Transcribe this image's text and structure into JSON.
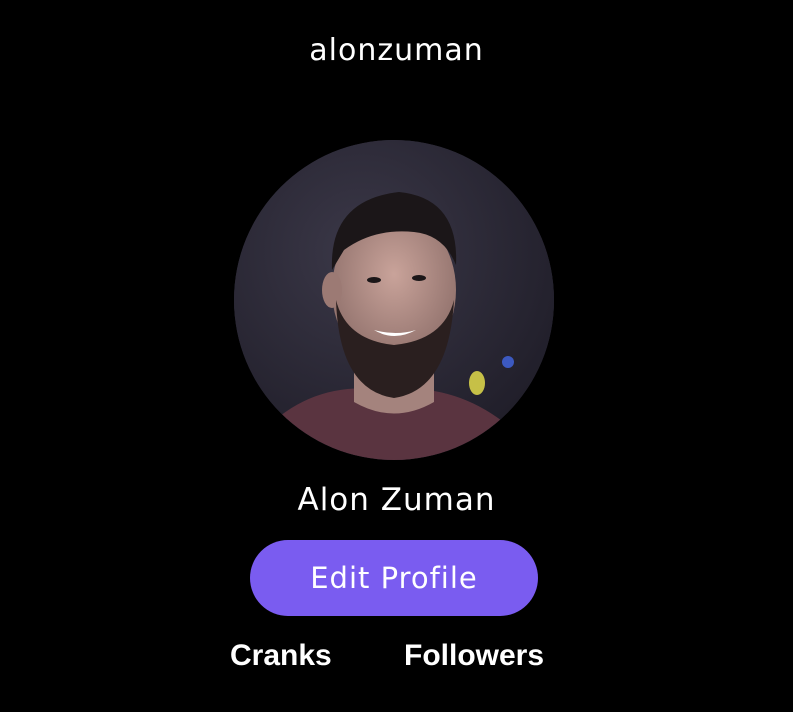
{
  "profile": {
    "username": "alonzuman",
    "display_name": "Alon Zuman",
    "avatar_icon": "profile-photo"
  },
  "actions": {
    "edit_profile_label": "Edit Profile"
  },
  "stats": {
    "cranks_label": "Cranks",
    "followers_label": "Followers"
  },
  "colors": {
    "background": "#000000",
    "text": "#ffffff",
    "accent": "#7a5cf0"
  }
}
